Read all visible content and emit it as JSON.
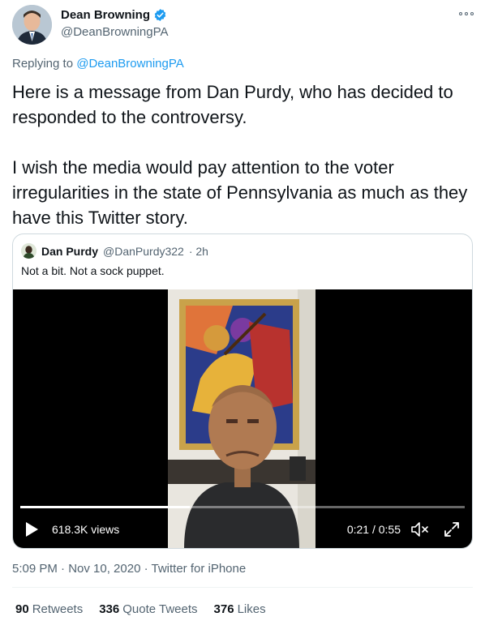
{
  "author": {
    "display_name": "Dean Browning",
    "handle": "@DeanBrowningPA",
    "verified_icon": "verified-badge-icon",
    "more_icon": "more-options-icon"
  },
  "reply": {
    "prefix": "Replying to",
    "handle": "@DeanBrowningPA"
  },
  "tweet": {
    "paragraph1": "Here is a message from Dan Purdy, who has decided to responded to the controversy.",
    "paragraph2": "I wish the media would pay attention to the voter irregularities in the state of Pennsylvania as much as they have this Twitter story."
  },
  "quote": {
    "display_name": "Dan Purdy",
    "handle": "@DanPurdy322",
    "age": "· 2h",
    "text": "Not a bit. Not a sock puppet.",
    "video": {
      "views": "618.3K views",
      "time": "0:21 / 0:55",
      "progress_fraction": 0.382
    }
  },
  "meta": {
    "timestamp": "5:09 PM · Nov 10, 2020 · Twitter for iPhone"
  },
  "stats": {
    "retweets_count": "90",
    "retweets_label": "Retweets",
    "quotes_count": "336",
    "quotes_label": "Quote Tweets",
    "likes_count": "376",
    "likes_label": "Likes"
  },
  "colors": {
    "accent": "#1d9bf0",
    "secondary_text": "#536471"
  }
}
